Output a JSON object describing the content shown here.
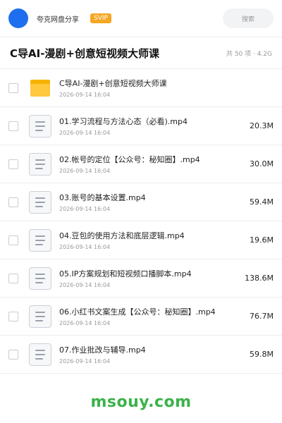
{
  "header": {
    "app_name": "夸克网盘分享",
    "badge": "SVIP",
    "search_label": "搜索"
  },
  "folder": {
    "title": "C导AI-漫剧+创意短视频大师课",
    "stats": "共 50 项 · 4.2G"
  },
  "files": [
    {
      "type": "folder",
      "name": "C导AI-漫剧+创意短视频大师课",
      "date": "2026-09-14 16:04",
      "size": ""
    },
    {
      "type": "video",
      "name": "01.学习流程与方法心态（必看).mp4",
      "date": "2026-09-14 16:04",
      "size": "20.3M"
    },
    {
      "type": "video",
      "name": "02.帐号的定位【公众号：秘知圈】.mp4",
      "date": "2026-09-14 16:04",
      "size": "30.0M"
    },
    {
      "type": "video",
      "name": "03.账号的基本设置.mp4",
      "date": "2026-09-14 16:04",
      "size": "59.4M"
    },
    {
      "type": "video",
      "name": "04.豆包的使用方法和底层逻辑.mp4",
      "date": "2026-09-14 16:04",
      "size": "19.6M"
    },
    {
      "type": "video",
      "name": "05.IP方案规划和短视频口播脚本.mp4",
      "date": "2026-09-14 16:04",
      "size": "138.6M"
    },
    {
      "type": "video",
      "name": "06.小红书文案生成【公众号：秘知圈】.mp4",
      "date": "2026-09-14 16:04",
      "size": "76.7M"
    },
    {
      "type": "video",
      "name": "07.作业批改与辅导.mp4",
      "date": "2026-09-14 16:04",
      "size": "59.8M"
    }
  ],
  "watermark": "msouy.com",
  "colors": {
    "accent": "#1e6ff0",
    "svip": "#f5a623",
    "folder": "#ffc83d",
    "watermark": "#3bb24a"
  },
  "icons": {
    "folder": "folder-icon",
    "video": "file-icon",
    "search": "search-icon"
  }
}
